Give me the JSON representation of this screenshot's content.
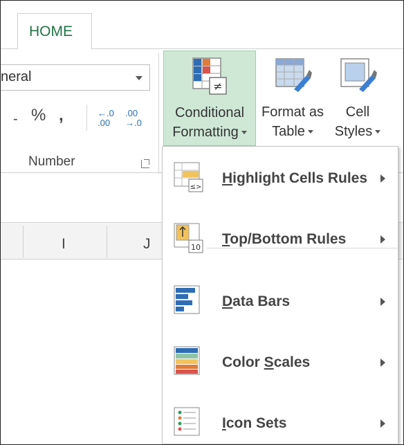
{
  "tabs": {
    "home": "HOME"
  },
  "number_group": {
    "format_value": "neral",
    "percent": "%",
    "comma": ",",
    "dash": "-",
    "inc_decimal_top": "←.0",
    "inc_decimal_bottom": ".00",
    "dec_decimal_top": ".00",
    "dec_decimal_bottom": "→.0",
    "label": "Number"
  },
  "styles_group": {
    "conditional_formatting_line1": "Conditional",
    "conditional_formatting_line2": "Formatting",
    "format_as_table_line1": "Format as",
    "format_as_table_line2": "Table",
    "cell_styles_line1": "Cell",
    "cell_styles_line2": "Styles"
  },
  "columns": [
    "I",
    "J"
  ],
  "menu": {
    "items": [
      {
        "prefix": "",
        "ul": "H",
        "rest": "ighlight Cells Rules",
        "icon": "highlight-cells-icon"
      },
      {
        "prefix": "",
        "ul": "T",
        "rest": "op/Bottom Rules",
        "icon": "top-bottom-icon"
      },
      {
        "prefix": "",
        "ul": "D",
        "rest": "ata Bars",
        "icon": "data-bars-icon"
      },
      {
        "prefix": "Color ",
        "ul": "S",
        "rest": "cales",
        "icon": "color-scales-icon"
      },
      {
        "prefix": "",
        "ul": "I",
        "rest": "con Sets",
        "icon": "icon-sets-icon"
      }
    ],
    "icon_text_ops": "≤>",
    "icon_text_ten": "10"
  },
  "colors": {
    "accent_green": "#217346",
    "pressed_bg": "#cfe8d6",
    "blue": "#2e6db4",
    "orange": "#e07b39",
    "red": "#d9534f"
  }
}
